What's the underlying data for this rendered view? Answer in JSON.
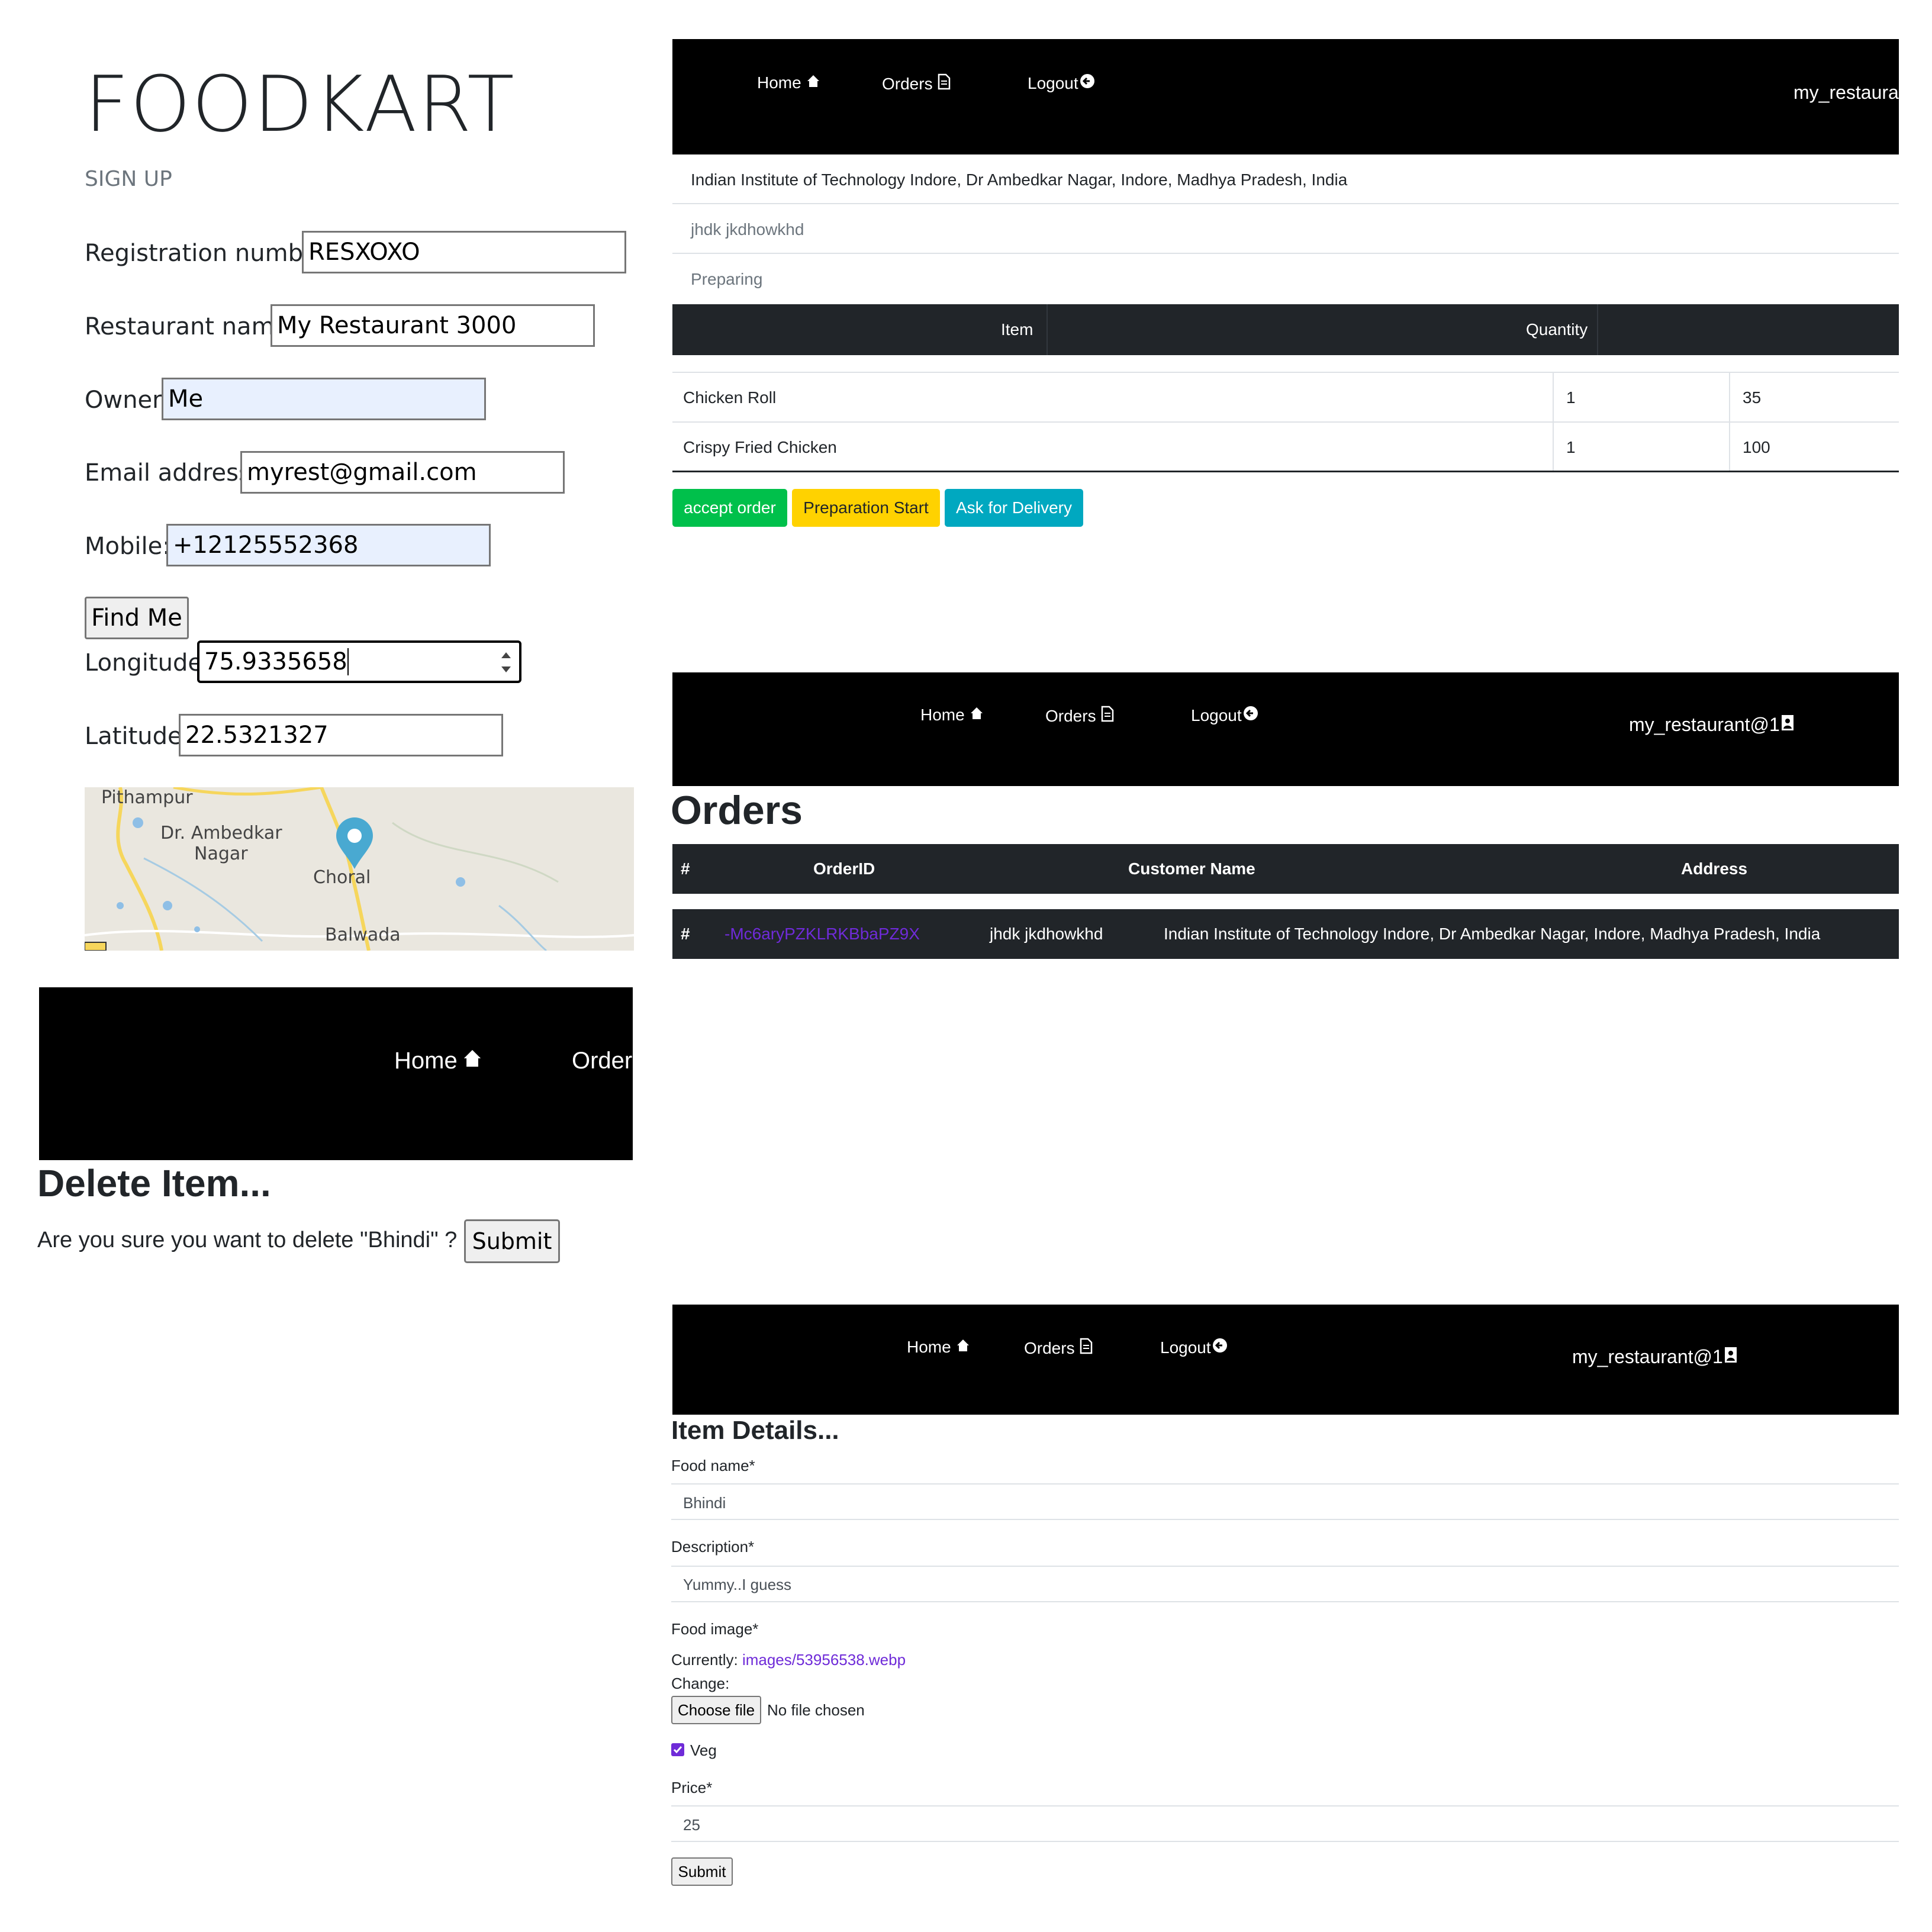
{
  "signup": {
    "brand": "FOODKART",
    "subtitle": "SIGN UP",
    "fields": {
      "registration": {
        "label": "Registration number:",
        "value": "RESXOXO"
      },
      "restaurant": {
        "label": "Restaurant name:",
        "value": "My Restaurant 3000"
      },
      "owner": {
        "label": "Owner:",
        "value": "Me"
      },
      "email": {
        "label": "Email address:",
        "value": "myrest@gmail.com"
      },
      "mobile": {
        "label": "Mobile:",
        "value": "+12125552368"
      },
      "longitude": {
        "label": "Longitude:",
        "value": "75.9335658"
      },
      "latitude": {
        "label": "Latitude:",
        "value": "22.5321327"
      }
    },
    "find_me_label": "Find Me",
    "map": {
      "places": [
        "Pithampur",
        "Dr. Ambedkar",
        "Nagar",
        "Choral",
        "Balwada"
      ],
      "marker_icon": "map-pin-icon"
    }
  },
  "nav": {
    "home": "Home",
    "orders": "Orders",
    "logout": "Logout",
    "user": "my_restaurant@1",
    "user_cut": "my_restaura",
    "orders_cut": "Orders",
    "icons": {
      "home": "home-icon",
      "orders": "document-icon",
      "logout": "arrow-left-circle-icon",
      "user": "user-badge-icon"
    }
  },
  "order_detail": {
    "address": "Indian Institute of Technology Indore, Dr Ambedkar Nagar, Indore, Madhya Pradesh, India",
    "customer": "jhdk jkdhowkhd",
    "status": "Preparing",
    "table_headers": [
      "Item",
      "Quantity"
    ],
    "rows": [
      {
        "item": "Chicken Roll",
        "quantity": "1",
        "price": "35"
      },
      {
        "item": "Crispy Fried Chicken",
        "quantity": "1",
        "price": "100"
      }
    ],
    "buttons": {
      "accept": "accept order",
      "prepare": "Preparation Start",
      "delivery": "Ask for Delivery"
    },
    "colors": {
      "accept": "#00c04b",
      "prepare": "#ffd200",
      "delivery": "#00a8c0"
    }
  },
  "orders_page": {
    "title": "Orders",
    "headers": [
      "#",
      "OrderID",
      "Customer Name",
      "Address"
    ],
    "row": {
      "num": "#",
      "order_id": "-Mc6aryPZKLRKBbaPZ9X",
      "customer": "jhdk jkdhowkhd",
      "address": "Indian Institute of Technology Indore, Dr Ambedkar Nagar, Indore, Madhya Pradesh, India"
    }
  },
  "delete_page": {
    "title": "Delete Item...",
    "question": "Are you sure you want to delete \"Bhindi\" ?",
    "submit": "Submit"
  },
  "item_details": {
    "title": "Item Details...",
    "food_name_label": "Food name*",
    "food_name_value": "Bhindi",
    "description_label": "Description*",
    "description_value": "Yummy..I guess",
    "image_label": "Food image*",
    "currently_label": "Currently:",
    "currently_link": "images/53956538.webp",
    "change_label": "Change:",
    "choose_file": "Choose file",
    "no_file": "No file chosen",
    "veg_label": "Veg",
    "veg_checked": true,
    "price_label": "Price*",
    "price_value": "25",
    "submit": "Submit"
  },
  "colors": {
    "link": "#6f42c1",
    "nav_bg": "#000000",
    "table_dark": "#212529"
  }
}
